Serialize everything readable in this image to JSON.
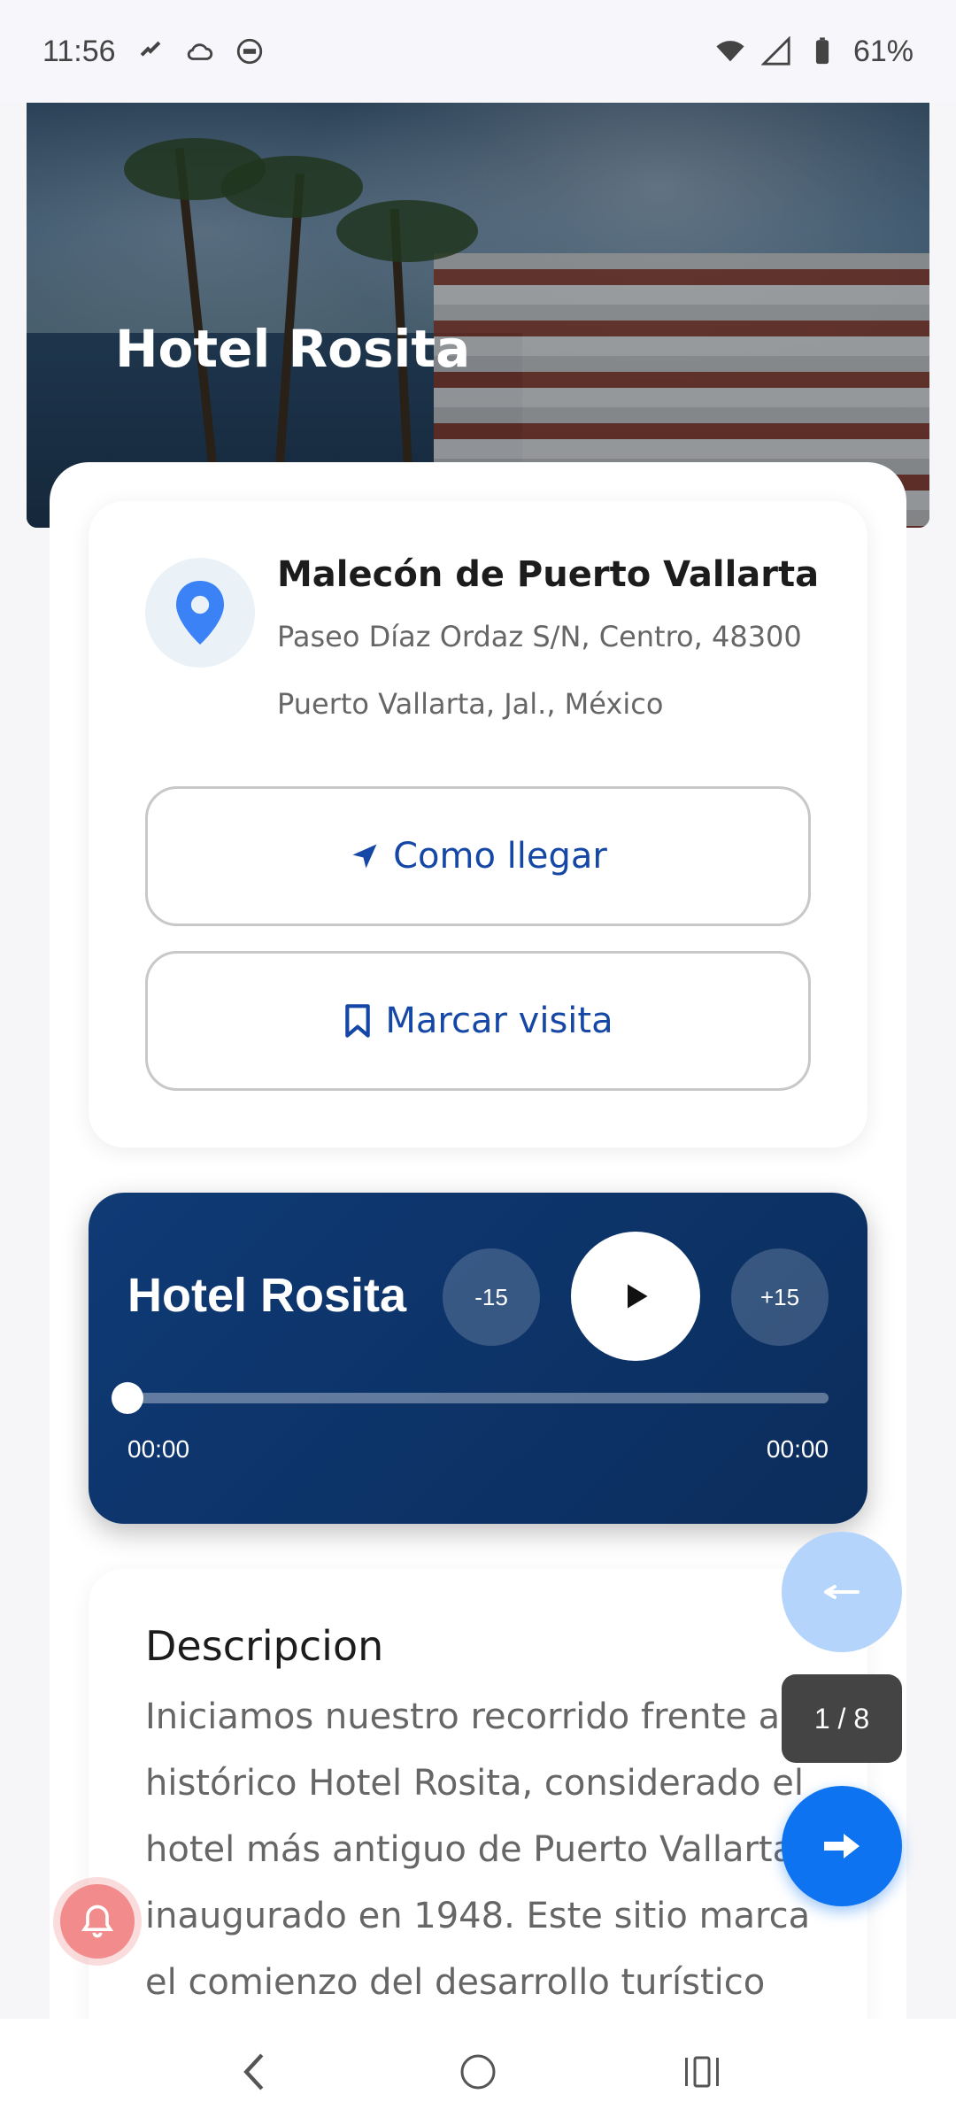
{
  "status_bar": {
    "time": "11:56",
    "battery": "61%",
    "icons": [
      "tiktok-icon",
      "cloud-icon",
      "media-icon",
      "wifi-icon",
      "signal-icon",
      "battery-icon"
    ]
  },
  "hero": {
    "title": "Hotel Rosita"
  },
  "location": {
    "title": "Malecón de Puerto Vallarta",
    "address_line1": "Paseo Díaz Ordaz S/N, Centro, 48300",
    "address_line2": "Puerto Vallarta, Jal., México",
    "directions_label": "Como llegar",
    "mark_visit_label": "Marcar visita"
  },
  "player": {
    "title": "Hotel Rosita",
    "skip_back_label": "-15",
    "skip_forward_label": "+15",
    "current_time": "00:00",
    "total_time": "00:00",
    "progress": 0
  },
  "description": {
    "title": "Descripcion",
    "text": "Iniciamos nuestro recorrido frente al histórico Hotel Rosita, considerado el hotel más antiguo de Puerto Vallarta, inaugurado en 1948. Este sitio marca el comienzo del desarrollo turístico"
  },
  "pager": {
    "counter": "1 / 8"
  },
  "colors": {
    "accent": "#0d73f0",
    "primary_text_blue": "#1547a6",
    "player_bg": "#0f3a75"
  }
}
